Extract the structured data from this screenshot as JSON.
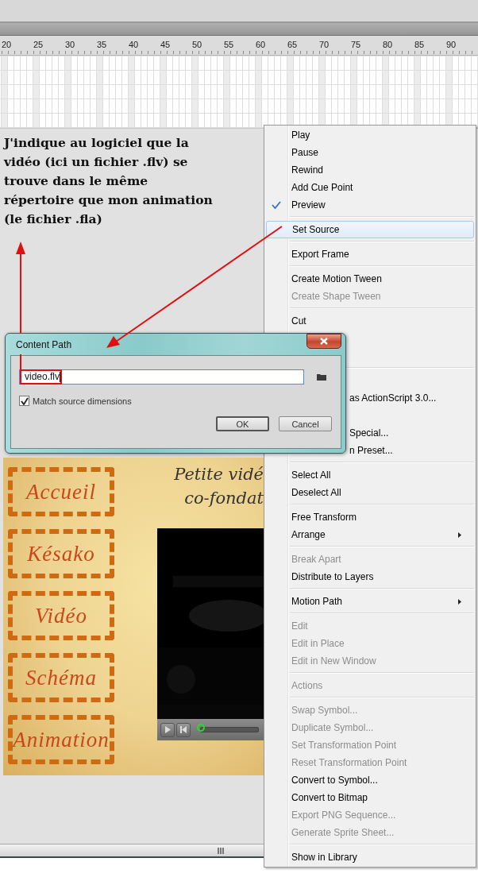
{
  "timeline": {
    "frame_numbers": [
      "20",
      "25",
      "30",
      "35",
      "40",
      "45",
      "50",
      "55",
      "60",
      "65",
      "70",
      "75",
      "80",
      "85",
      "90"
    ]
  },
  "annotation": {
    "text": "J'indique au logiciel que la\nvidéo (ici un fichier .flv) se\ntrouve dans le même\nrépertoire que mon animation\n(le fichier .fla)"
  },
  "stage": {
    "nav_buttons": [
      "Accueil",
      "Késako",
      "Vidéo",
      "Schéma",
      "Animation"
    ],
    "title_lines": [
      "Petite vidé",
      "co-fondat"
    ],
    "video_player": {
      "seek": {
        "level": 0
      }
    }
  },
  "context_menu": {
    "items": [
      {
        "kind": "item",
        "label": "Play",
        "disabled": false,
        "checked": false,
        "selected": false,
        "submenu": false
      },
      {
        "kind": "item",
        "label": "Pause",
        "disabled": false,
        "checked": false,
        "selected": false,
        "submenu": false
      },
      {
        "kind": "item",
        "label": "Rewind",
        "disabled": false,
        "checked": false,
        "selected": false,
        "submenu": false
      },
      {
        "kind": "item",
        "label": "Add Cue Point",
        "disabled": false,
        "checked": false,
        "selected": false,
        "submenu": false
      },
      {
        "kind": "item",
        "label": "Preview",
        "disabled": false,
        "checked": true,
        "selected": false,
        "submenu": false
      },
      {
        "kind": "separator"
      },
      {
        "kind": "item",
        "label": "Set Source",
        "disabled": false,
        "checked": false,
        "selected": true,
        "submenu": false
      },
      {
        "kind": "separator"
      },
      {
        "kind": "item",
        "label": "Export Frame",
        "disabled": false,
        "checked": false,
        "selected": false,
        "submenu": false
      },
      {
        "kind": "separator"
      },
      {
        "kind": "item",
        "label": "Create Motion Tween",
        "disabled": false,
        "checked": false,
        "selected": false,
        "submenu": false
      },
      {
        "kind": "item",
        "label": "Create Shape Tween",
        "disabled": true,
        "checked": false,
        "selected": false,
        "submenu": false
      },
      {
        "kind": "separator"
      },
      {
        "kind": "item",
        "label": "Cut",
        "disabled": false,
        "checked": false,
        "selected": false,
        "submenu": false
      },
      {
        "kind": "covered"
      },
      {
        "kind": "covered"
      },
      {
        "kind": "separator"
      },
      {
        "kind": "covered"
      },
      {
        "kind": "partial",
        "label": "as ActionScript 3.0...",
        "disabled": false,
        "checked": false,
        "selected": false,
        "submenu": false
      },
      {
        "kind": "covered"
      },
      {
        "kind": "partial",
        "label": "Special...",
        "disabled": false,
        "checked": false,
        "selected": false,
        "submenu": false
      },
      {
        "kind": "partial",
        "label": "n Preset...",
        "disabled": false,
        "checked": false,
        "selected": false,
        "submenu": false
      },
      {
        "kind": "separator"
      },
      {
        "kind": "item",
        "label": "Select All",
        "disabled": false,
        "checked": false,
        "selected": false,
        "submenu": false
      },
      {
        "kind": "item",
        "label": "Deselect All",
        "disabled": false,
        "checked": false,
        "selected": false,
        "submenu": false
      },
      {
        "kind": "separator"
      },
      {
        "kind": "item",
        "label": "Free Transform",
        "disabled": false,
        "checked": false,
        "selected": false,
        "submenu": false
      },
      {
        "kind": "item",
        "label": "Arrange",
        "disabled": false,
        "checked": false,
        "selected": false,
        "submenu": true
      },
      {
        "kind": "separator"
      },
      {
        "kind": "item",
        "label": "Break Apart",
        "disabled": true,
        "checked": false,
        "selected": false,
        "submenu": false
      },
      {
        "kind": "item",
        "label": "Distribute to Layers",
        "disabled": false,
        "checked": false,
        "selected": false,
        "submenu": false
      },
      {
        "kind": "separator"
      },
      {
        "kind": "item",
        "label": "Motion Path",
        "disabled": false,
        "checked": false,
        "selected": false,
        "submenu": true
      },
      {
        "kind": "separator"
      },
      {
        "kind": "item",
        "label": "Edit",
        "disabled": true,
        "checked": false,
        "selected": false,
        "submenu": false
      },
      {
        "kind": "item",
        "label": "Edit in Place",
        "disabled": true,
        "checked": false,
        "selected": false,
        "submenu": false
      },
      {
        "kind": "item",
        "label": "Edit in New Window",
        "disabled": true,
        "checked": false,
        "selected": false,
        "submenu": false
      },
      {
        "kind": "separator"
      },
      {
        "kind": "item",
        "label": "Actions",
        "disabled": true,
        "checked": false,
        "selected": false,
        "submenu": false
      },
      {
        "kind": "separator"
      },
      {
        "kind": "item",
        "label": "Swap Symbol...",
        "disabled": true,
        "checked": false,
        "selected": false,
        "submenu": false
      },
      {
        "kind": "item",
        "label": "Duplicate Symbol...",
        "disabled": true,
        "checked": false,
        "selected": false,
        "submenu": false
      },
      {
        "kind": "item",
        "label": "Set Transformation Point",
        "disabled": true,
        "checked": false,
        "selected": false,
        "submenu": false
      },
      {
        "kind": "item",
        "label": "Reset Transformation Point",
        "disabled": true,
        "checked": false,
        "selected": false,
        "submenu": false
      },
      {
        "kind": "item",
        "label": "Convert to Symbol...",
        "disabled": false,
        "checked": false,
        "selected": false,
        "submenu": false
      },
      {
        "kind": "item",
        "label": "Convert to Bitmap",
        "disabled": false,
        "checked": false,
        "selected": false,
        "submenu": false
      },
      {
        "kind": "item",
        "label": "Export PNG Sequence...",
        "disabled": true,
        "checked": false,
        "selected": false,
        "submenu": false
      },
      {
        "kind": "item",
        "label": "Generate Sprite Sheet...",
        "disabled": true,
        "checked": false,
        "selected": false,
        "submenu": false
      },
      {
        "kind": "separator"
      },
      {
        "kind": "item",
        "label": "Show in Library",
        "disabled": false,
        "checked": false,
        "selected": false,
        "submenu": false
      }
    ]
  },
  "dialog": {
    "title": "Content Path",
    "path_value": "video.flv",
    "path_highlighted": true,
    "match_source_dimensions": {
      "label": "Match source dimensions",
      "checked": true
    },
    "buttons": [
      {
        "label": "OK",
        "default": true
      },
      {
        "label": "Cancel",
        "default": false
      }
    ]
  }
}
